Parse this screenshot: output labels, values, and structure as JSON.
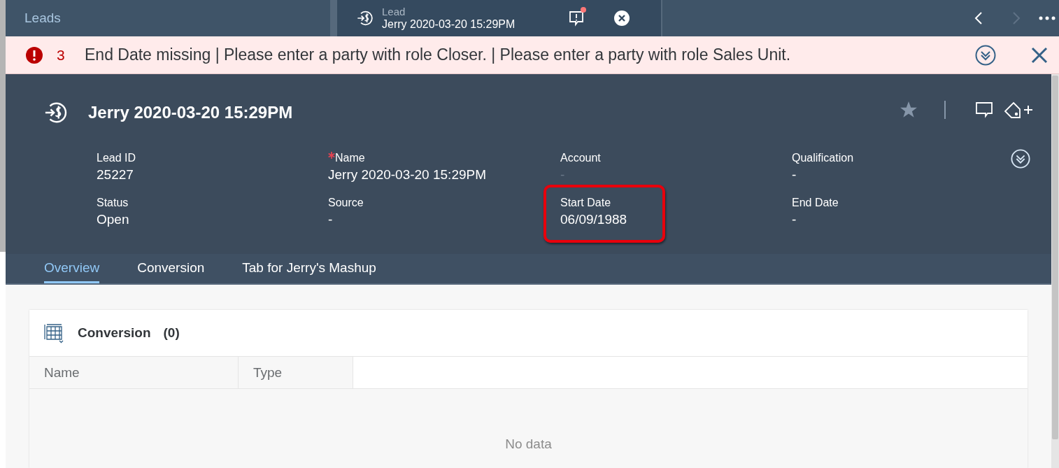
{
  "top_bar": {
    "tabs": [
      {
        "label": "Leads",
        "selected": false
      },
      {
        "label": "Lead",
        "title": "Jerry 2020-03-20 15:29PM",
        "selected": true,
        "notification": true
      }
    ],
    "nav": [
      {
        "kind": "previous",
        "disabled": false
      },
      {
        "kind": "next",
        "disabled": true
      }
    ]
  },
  "message_strip": {
    "count": "3",
    "text": "End Date missing | Please enter a party with role Closer. | Please enter a party with role Sales Unit."
  },
  "header": {
    "title": "Jerry 2020-03-20 15:29PM",
    "fields": [
      {
        "label": "Lead ID",
        "value": "25227",
        "required": false,
        "disabled": false,
        "highlighted": false
      },
      {
        "label": "Name",
        "value": "Jerry 2020-03-20 15:29PM",
        "required": true,
        "disabled": false,
        "highlighted": false
      },
      {
        "label": "Account",
        "value": "-",
        "required": false,
        "disabled": true,
        "highlighted": false
      },
      {
        "label": "Qualification",
        "value": "-",
        "required": false,
        "disabled": false,
        "highlighted": false
      },
      {
        "label": "Status",
        "value": "Open",
        "required": false,
        "disabled": false,
        "highlighted": false
      },
      {
        "label": "Source",
        "value": "-",
        "required": false,
        "disabled": false,
        "highlighted": false
      },
      {
        "label": "Start Date",
        "value": "06/09/1988",
        "required": false,
        "disabled": false,
        "highlighted": true
      },
      {
        "label": "End Date",
        "value": "-",
        "required": false,
        "disabled": false,
        "highlighted": false
      }
    ]
  },
  "tabs": [
    {
      "label": "Overview",
      "selected": true
    },
    {
      "label": "Conversion",
      "selected": false
    },
    {
      "label": "Tab for Jerry's Mashup",
      "selected": false
    }
  ],
  "table": {
    "title": "Conversion",
    "count": "(0)",
    "columns": [
      "Name",
      "Type"
    ],
    "empty_text": "No data"
  }
}
